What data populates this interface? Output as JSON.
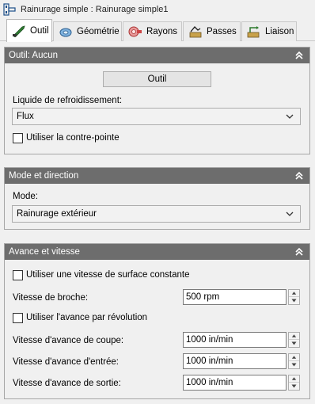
{
  "window": {
    "title": "Rainurage simple : Rainurage simple1",
    "icon": "groove-operation-icon"
  },
  "tabs": [
    {
      "label": "Outil",
      "icon": "tool-icon",
      "active": true
    },
    {
      "label": "Géométrie",
      "icon": "geometry-icon",
      "active": false
    },
    {
      "label": "Rayons",
      "icon": "radii-icon",
      "active": false
    },
    {
      "label": "Passes",
      "icon": "passes-icon",
      "active": false
    },
    {
      "label": "Liaison",
      "icon": "linking-icon",
      "active": false
    }
  ],
  "tool_panel": {
    "header": "Outil: Aucun",
    "tool_button": "Outil",
    "coolant_label": "Liquide de refroidissement:",
    "coolant_value": "Flux",
    "tailstock_label": "Utiliser la contre-pointe",
    "tailstock_checked": false
  },
  "mode_panel": {
    "header": "Mode et direction",
    "mode_label": "Mode:",
    "mode_value": "Rainurage extérieur"
  },
  "feed_panel": {
    "header": "Avance et vitesse",
    "css_label": "Utiliser une vitesse de surface constante",
    "css_checked": false,
    "spindle_label": "Vitesse de broche:",
    "spindle_value": "500 rpm",
    "feed_per_rev_label": "Utiliser l'avance par révolution",
    "feed_per_rev_checked": false,
    "cutting_feed_label": "Vitesse d'avance de coupe:",
    "cutting_feed_value": "1000 in/min",
    "lead_in_label": "Vitesse d'avance d'entrée:",
    "lead_in_value": "1000 in/min",
    "lead_out_label": "Vitesse d'avance de sortie:",
    "lead_out_value": "1000 in/min"
  },
  "colors": {
    "panel_header": "#6d6d6d",
    "background": "#f0f0f0",
    "tab_active": "#ffffff"
  }
}
